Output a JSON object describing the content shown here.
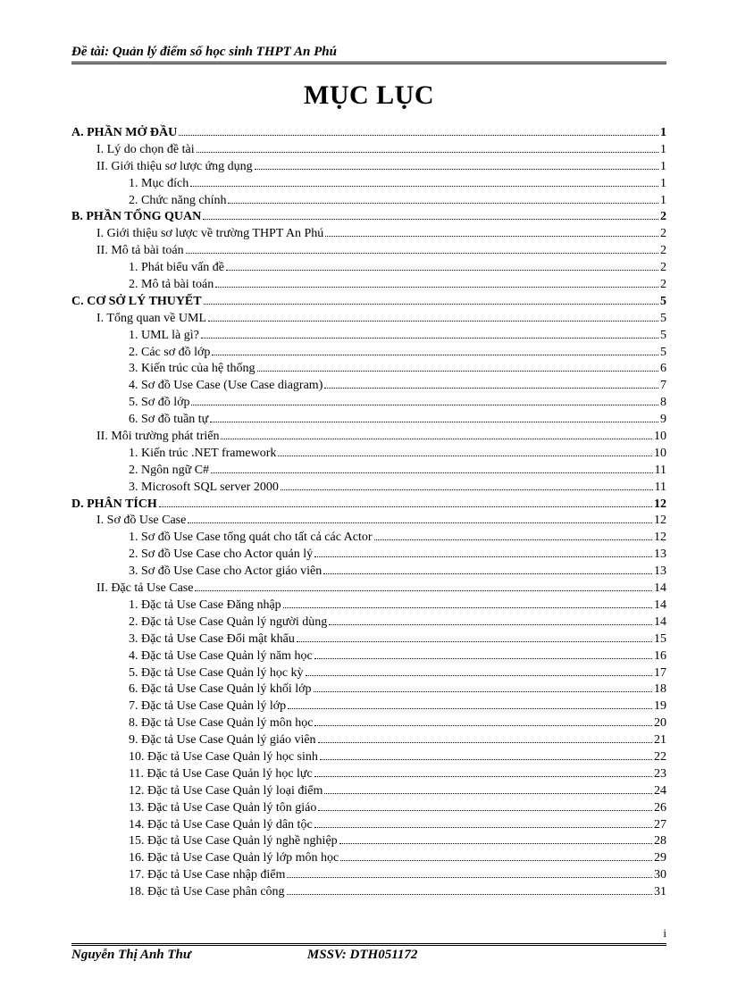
{
  "header": {
    "title": "Đề tài: Quản lý điểm số học sinh THPT An Phú"
  },
  "main_title": "MỤC LỤC",
  "toc": [
    {
      "level": 0,
      "label": "A. PHẦN MỞ ĐẦU",
      "page": "1"
    },
    {
      "level": 1,
      "label": "I. Lý do chọn đề tài",
      "page": "1"
    },
    {
      "level": 1,
      "label": "II. Giới thiệu sơ lược ứng dụng",
      "page": "1"
    },
    {
      "level": 2,
      "label": "1. Mục đích",
      "page": "1"
    },
    {
      "level": 2,
      "label": "2. Chức năng chính",
      "page": "1"
    },
    {
      "level": 0,
      "label": "B. PHẦN TỔNG QUAN",
      "page": "2"
    },
    {
      "level": 1,
      "label": "I. Giới thiệu sơ lược về trường THPT An Phú",
      "page": "2"
    },
    {
      "level": 1,
      "label": "II. Mô tả bài toán",
      "page": "2"
    },
    {
      "level": 2,
      "label": "1. Phát biểu vấn đề",
      "page": "2"
    },
    {
      "level": 2,
      "label": "2. Mô tả bài toán",
      "page": "2"
    },
    {
      "level": 0,
      "label": "C. CƠ SỞ LÝ THUYẾT",
      "page": "5"
    },
    {
      "level": 1,
      "label": "I. Tổng quan về UML",
      "page": "5"
    },
    {
      "level": 2,
      "label": "1. UML là gì?",
      "page": "5"
    },
    {
      "level": 2,
      "label": "2. Các sơ đồ lớp",
      "page": "5"
    },
    {
      "level": 2,
      "label": "3. Kiến trúc của hệ thống",
      "page": "6"
    },
    {
      "level": 2,
      "label": "4. Sơ đồ Use Case (Use Case diagram)",
      "page": "7"
    },
    {
      "level": 2,
      "label": "5. Sơ đồ lớp",
      "page": "8"
    },
    {
      "level": 2,
      "label": "6. Sơ đồ tuần tự",
      "page": "9"
    },
    {
      "level": 1,
      "label": "II. Môi trường phát triển",
      "page": "10"
    },
    {
      "level": 2,
      "label": "1. Kiến trúc .NET framework",
      "page": "10"
    },
    {
      "level": 2,
      "label": "2. Ngôn ngữ C#",
      "page": "11"
    },
    {
      "level": 2,
      "label": "3. Microsoft  SQL server 2000",
      "page": "11"
    },
    {
      "level": 0,
      "label": "D. PHÂN TÍCH",
      "page": "12"
    },
    {
      "level": 1,
      "label": "I. Sơ đồ Use Case",
      "page": "12"
    },
    {
      "level": 2,
      "label": "1. Sơ đồ Use Case tổng quát cho tất cả các Actor",
      "page": "12"
    },
    {
      "level": 2,
      "label": "2. Sơ đồ Use Case cho Actor quản lý",
      "page": "13"
    },
    {
      "level": 2,
      "label": "3. Sơ đồ Use Case cho Actor giáo viên",
      "page": "13"
    },
    {
      "level": 1,
      "label": "II. Đặc tả Use Case",
      "page": "14"
    },
    {
      "level": 2,
      "label": "1. Đặc tả Use Case Đăng nhập",
      "page": "14"
    },
    {
      "level": 2,
      "label": "2. Đặc tả Use Case Quản lý người dùng",
      "page": "14"
    },
    {
      "level": 2,
      "label": "3. Đặc tả Use Case Đổi mật khẩu",
      "page": "15"
    },
    {
      "level": 2,
      "label": "4. Đặc tả Use Case Quản lý năm học",
      "page": "16"
    },
    {
      "level": 2,
      "label": "5. Đặc tả Use Case Quản lý học kỳ",
      "page": "17"
    },
    {
      "level": 2,
      "label": "6. Đặc tả Use Case Quản lý khối lớp",
      "page": "18"
    },
    {
      "level": 2,
      "label": "7. Đặc tả Use Case Quản lý lớp",
      "page": "19"
    },
    {
      "level": 2,
      "label": "8. Đặc tả Use Case Quản lý môn học",
      "page": "20"
    },
    {
      "level": 2,
      "label": "9. Đặc tả Use Case Quản lý giáo viên",
      "page": "21"
    },
    {
      "level": 2,
      "label": "10. Đặc tả Use Case Quản lý học sinh",
      "page": "22"
    },
    {
      "level": 2,
      "label": "11. Đặc tả Use Case Quản lý học lực",
      "page": "23"
    },
    {
      "level": 2,
      "label": "12. Đặc tả Use Case Quản lý loại điểm",
      "page": "24"
    },
    {
      "level": 2,
      "label": "13. Đặc tả Use Case Quản lý tôn giáo",
      "page": "26"
    },
    {
      "level": 2,
      "label": "14. Đặc tả Use Case Quản lý dân tộc",
      "page": "27"
    },
    {
      "level": 2,
      "label": "15. Đặc tả Use Case Quản lý nghề nghiệp",
      "page": "28"
    },
    {
      "level": 2,
      "label": "16. Đặc tả Use Case Quản lý lớp môn học",
      "page": "29"
    },
    {
      "level": 2,
      "label": "17. Đặc tả Use Case nhập điểm",
      "page": "30"
    },
    {
      "level": 2,
      "label": "18. Đặc tả Use Case phân công",
      "page": "31"
    }
  ],
  "footer": {
    "author": "Nguyễn Thị Anh Thư",
    "mssv_label": "MSSV: DTH051172",
    "page_number": "i"
  }
}
